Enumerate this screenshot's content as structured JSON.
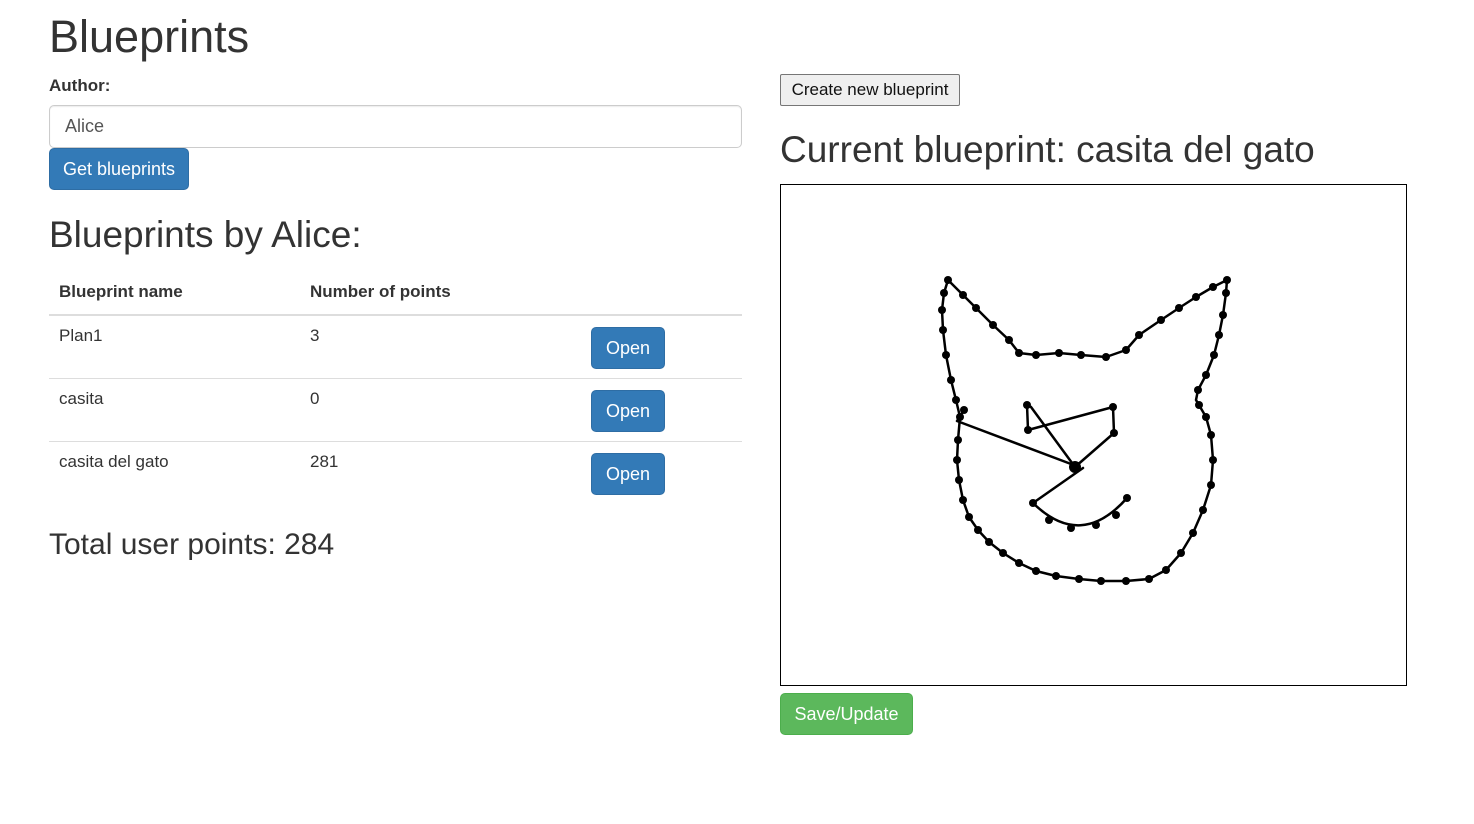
{
  "header": {
    "title": "Blueprints"
  },
  "author": {
    "label": "Author:",
    "value": "Alice"
  },
  "buttons": {
    "get_blueprints": "Get blueprints",
    "create_new": "Create new blueprint",
    "save_update": "Save/Update"
  },
  "list": {
    "title": "Blueprints by Alice:",
    "columns": [
      "Blueprint name",
      "Number of points"
    ],
    "open_label": "Open",
    "rows": [
      {
        "name": "Plan1",
        "points": "3"
      },
      {
        "name": "casita",
        "points": "0"
      },
      {
        "name": "casita del gato",
        "points": "281"
      }
    ]
  },
  "total": {
    "label": "Total user points: ",
    "value": "284"
  },
  "current": {
    "title": "Current blueprint: casita del gato"
  },
  "colors": {
    "primary": "#337ab7",
    "success": "#5cb85c",
    "stroke": "#000000"
  }
}
